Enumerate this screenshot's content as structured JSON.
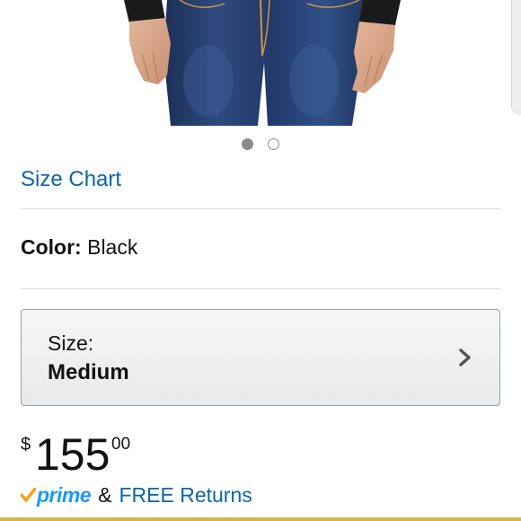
{
  "carousel": {
    "dot_count": 2,
    "active_index": 0
  },
  "size_chart_link": "Size Chart",
  "color": {
    "label": "Color:",
    "value": "Black"
  },
  "size_selector": {
    "label": "Size:",
    "value": "Medium",
    "icon": "chevron-right-icon"
  },
  "price": {
    "currency_symbol": "$",
    "whole": "155",
    "fraction": "00"
  },
  "shipping": {
    "prime_label": "prime",
    "ampersand": "&",
    "returns_link": "FREE Returns"
  },
  "colors": {
    "link": "#0a66a8",
    "prime": "#1a98ff",
    "prime_check": "#f7a41d",
    "bottom_bar": "#d9b44a"
  }
}
